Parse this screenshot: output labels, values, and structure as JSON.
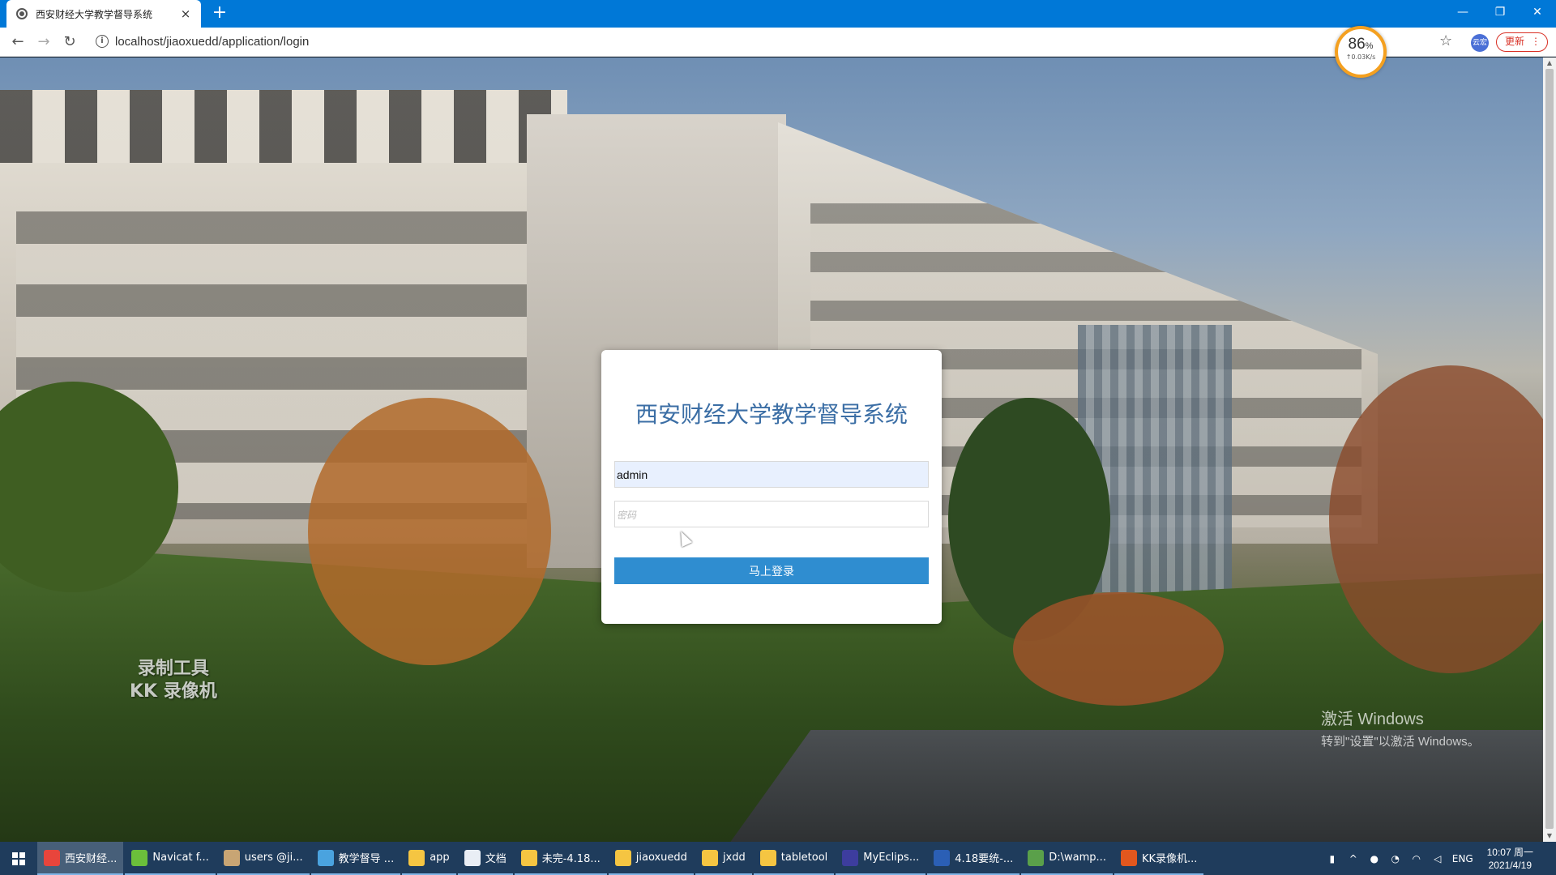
{
  "browser": {
    "tab_title": "西安财经大学教学督导系统",
    "tab_close": "×",
    "new_tab": "+",
    "url": "localhost/jiaoxuedd/application/login",
    "update_label": "更新",
    "update_menu": "⋮",
    "profile": "云宏",
    "window_controls": {
      "minimize": "—",
      "restore": "❐",
      "close": "✕"
    },
    "nav": {
      "back": "←",
      "forward": "→",
      "reload": "↻"
    }
  },
  "speed_widget": {
    "percent": "86",
    "percent_sign": "%",
    "rate": "↑0.03K/s"
  },
  "login": {
    "title": "西安财经大学教学督导系统",
    "username_value": "admin",
    "password_placeholder": "密码",
    "submit_label": "马上登录"
  },
  "watermark": {
    "line1": "录制工具",
    "line2": "KK 录像机"
  },
  "activation": {
    "line1": "激活 Windows",
    "line2": "转到\"设置\"以激活 Windows。"
  },
  "taskbar": {
    "items": [
      {
        "label": "西安财经...",
        "color": "#e8453c"
      },
      {
        "label": "Navicat f...",
        "color": "#6bbf3b"
      },
      {
        "label": "users @ji...",
        "color": "#c8a574"
      },
      {
        "label": "教学督导 ...",
        "color": "#4aa3df"
      },
      {
        "label": "app",
        "color": "#f5c542"
      },
      {
        "label": "文档",
        "color": "#e9eef5"
      },
      {
        "label": "未完-4.18...",
        "color": "#f5c542"
      },
      {
        "label": "jiaoxuedd",
        "color": "#f5c542"
      },
      {
        "label": "jxdd",
        "color": "#f5c542"
      },
      {
        "label": "tabletool",
        "color": "#f5c542"
      },
      {
        "label": "MyEclips...",
        "color": "#3d3d9e"
      },
      {
        "label": "4.18要统-...",
        "color": "#2b5fb5"
      },
      {
        "label": "D:\\wamp...",
        "color": "#5aa04a"
      },
      {
        "label": "KK录像机...",
        "color": "#e2571e"
      }
    ],
    "tray": {
      "lang": "ENG",
      "time": "10:07 周一",
      "date": "2021/4/19"
    }
  },
  "colors": {
    "accent": "#2f8dd0",
    "title_blue": "#3b6ea5",
    "titlebar": "#0078d7",
    "taskbar": "#1f3c5c"
  }
}
